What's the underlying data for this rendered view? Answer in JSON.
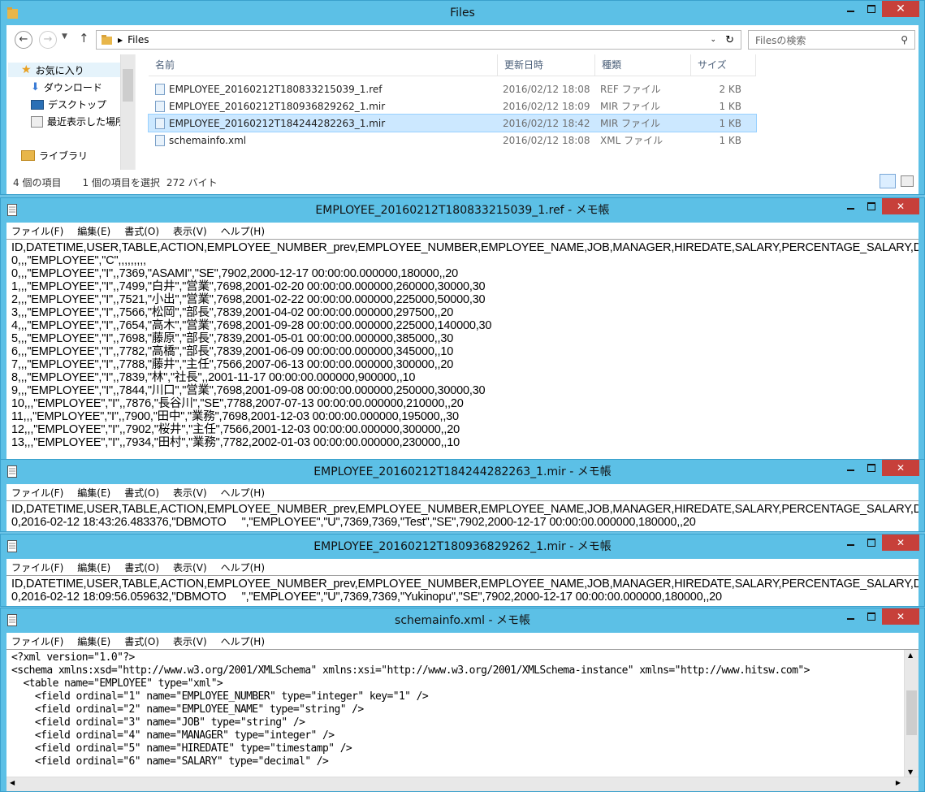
{
  "explorer": {
    "title": "Files",
    "breadcrumb": "Files",
    "search_placeholder": "Filesの検索",
    "nav": {
      "favorites": "お気に入り",
      "downloads": "ダウンロード",
      "desktop": "デスクトップ",
      "recent": "最近表示した場所",
      "libraries": "ライブラリ"
    },
    "columns": [
      "名前",
      "更新日時",
      "種類",
      "サイズ"
    ],
    "files": [
      {
        "name": "EMPLOYEE_20160212T180833215039_1.ref",
        "date": "2016/02/12 18:08",
        "type": "REF ファイル",
        "size": "2 KB"
      },
      {
        "name": "EMPLOYEE_20160212T180936829262_1.mir",
        "date": "2016/02/12 18:09",
        "type": "MIR ファイル",
        "size": "1 KB"
      },
      {
        "name": "EMPLOYEE_20160212T184244282263_1.mir",
        "date": "2016/02/12 18:42",
        "type": "MIR ファイル",
        "size": "1 KB"
      },
      {
        "name": "schemainfo.xml",
        "date": "2016/02/12 18:08",
        "type": "XML ファイル",
        "size": "1 KB"
      }
    ],
    "status_count": "4 個の項目",
    "status_selected": "1 個の項目を選択",
    "status_size": "272 バイト"
  },
  "menu": {
    "file": "ファイル(F)",
    "edit": "編集(E)",
    "format": "書式(O)",
    "view": "表示(V)",
    "help": "ヘルプ(H)"
  },
  "notepad1": {
    "title": "EMPLOYEE_20160212T180833215039_1.ref - メモ帳",
    "lines": [
      "ID,DATETIME,USER,TABLE,ACTION,EMPLOYEE_NUMBER_prev,EMPLOYEE_NUMBER,EMPLOYEE_NAME,JOB,MANAGER,HIREDATE,SALARY,PERCENTAGE_SALARY,DEPARTMENT",
      "0,,,\"EMPLOYEE\",\"C\",,,,,,,,,",
      "0,,,\"EMPLOYEE\",\"I\",,7369,\"ASAMI\",\"SE\",7902,2000-12-17 00:00:00.000000,180000,,20",
      "1,,,\"EMPLOYEE\",\"I\",,7499,\"白井\",\"営業\",7698,2001-02-20 00:00:00.000000,260000,30000,30",
      "2,,,\"EMPLOYEE\",\"I\",,7521,\"小出\",\"営業\",7698,2001-02-22 00:00:00.000000,225000,50000,30",
      "3,,,\"EMPLOYEE\",\"I\",,7566,\"松岡\",\"部長\",7839,2001-04-02 00:00:00.000000,297500,,20",
      "4,,,\"EMPLOYEE\",\"I\",,7654,\"高木\",\"営業\",7698,2001-09-28 00:00:00.000000,225000,140000,30",
      "5,,,\"EMPLOYEE\",\"I\",,7698,\"藤原\",\"部長\",7839,2001-05-01 00:00:00.000000,385000,,30",
      "6,,,\"EMPLOYEE\",\"I\",,7782,\"高橋\",\"部長\",7839,2001-06-09 00:00:00.000000,345000,,10",
      "7,,,\"EMPLOYEE\",\"I\",,7788,\"藤井\",\"主任\",7566,2007-06-13 00:00:00.000000,300000,,20",
      "8,,,\"EMPLOYEE\",\"I\",,7839,\"林\",\"社長\",,2001-11-17 00:00:00.000000,900000,,10",
      "9,,,\"EMPLOYEE\",\"I\",,7844,\"川口\",\"営業\",7698,2001-09-08 00:00:00.000000,250000,30000,30",
      "10,,,\"EMPLOYEE\",\"I\",,7876,\"長谷川\",\"SE\",7788,2007-07-13 00:00:00.000000,210000,,20",
      "11,,,\"EMPLOYEE\",\"I\",,7900,\"田中\",\"業務\",7698,2001-12-03 00:00:00.000000,195000,,30",
      "12,,,\"EMPLOYEE\",\"I\",,7902,\"桜井\",\"主任\",7566,2001-12-03 00:00:00.000000,300000,,20",
      "13,,,\"EMPLOYEE\",\"I\",,7934,\"田村\",\"業務\",7782,2002-01-03 00:00:00.000000,230000,,10"
    ]
  },
  "notepad2": {
    "title": "EMPLOYEE_20160212T184244282263_1.mir - メモ帳",
    "lines": [
      "ID,DATETIME,USER,TABLE,ACTION,EMPLOYEE_NUMBER_prev,EMPLOYEE_NUMBER,EMPLOYEE_NAME,JOB,MANAGER,HIREDATE,SALARY,PERCENTAGE_SALARY,DEPARTMENT",
      "0,2016-02-12 18:43:26.483376,\"DBMOTO     \",\"EMPLOYEE\",\"U\",7369,7369,\"Test\",\"SE\",7902,2000-12-17 00:00:00.000000,180000,,20"
    ]
  },
  "notepad3": {
    "title": "EMPLOYEE_20160212T180936829262_1.mir - メモ帳",
    "lines": [
      "ID,DATETIME,USER,TABLE,ACTION,EMPLOYEE_NUMBER_prev,EMPLOYEE_NUMBER,EMPLOYEE_NAME,JOB,MANAGER,HIREDATE,SALARY,PERCENTAGE_SALARY,DEPARTMENT",
      "0,2016-02-12 18:09:56.059632,\"DBMOTO     \",\"EMPLOYEE\",\"U\",7369,7369,\"Yukinopu\",\"SE\",7902,2000-12-17 00:00:00.000000,180000,,20"
    ]
  },
  "notepad4": {
    "title": "schemainfo.xml - メモ帳",
    "lines": [
      "<?xml version=\"1.0\"?>",
      "<schema xmlns:xsd=\"http://www.w3.org/2001/XMLSchema\" xmlns:xsi=\"http://www.w3.org/2001/XMLSchema-instance\" xmlns=\"http://www.hitsw.com\">",
      "  <table name=\"EMPLOYEE\" type=\"xml\">",
      "    <field ordinal=\"1\" name=\"EMPLOYEE_NUMBER\" type=\"integer\" key=\"1\" />",
      "    <field ordinal=\"2\" name=\"EMPLOYEE_NAME\" type=\"string\" />",
      "    <field ordinal=\"3\" name=\"JOB\" type=\"string\" />",
      "    <field ordinal=\"4\" name=\"MANAGER\" type=\"integer\" />",
      "    <field ordinal=\"5\" name=\"HIREDATE\" type=\"timestamp\" />",
      "    <field ordinal=\"6\" name=\"SALARY\" type=\"decimal\" />"
    ]
  }
}
